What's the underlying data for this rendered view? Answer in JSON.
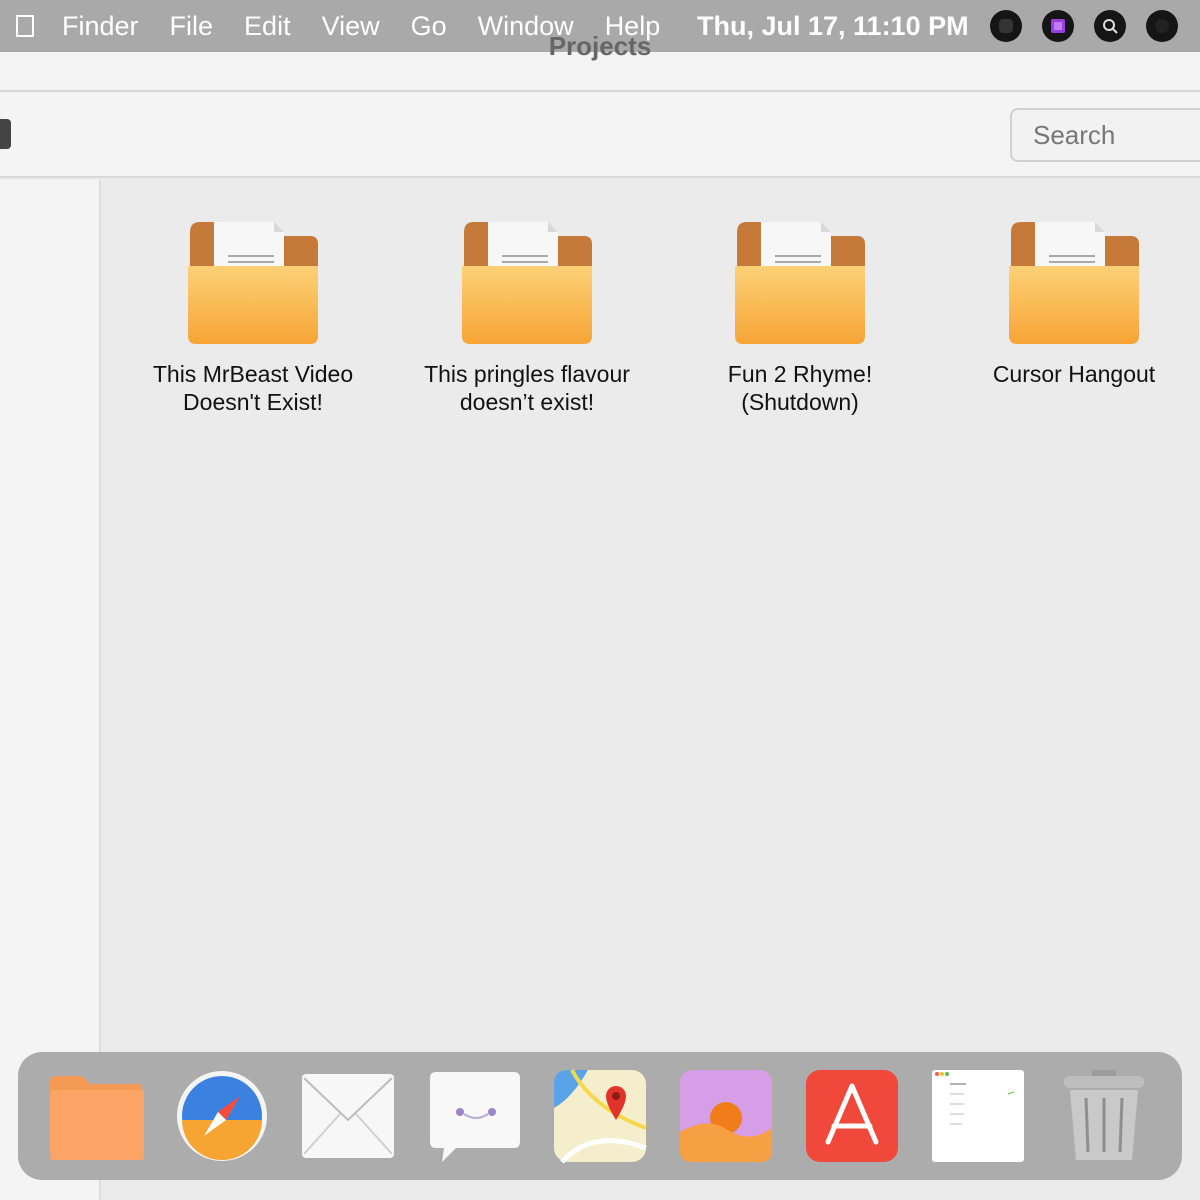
{
  "menubar": {
    "apple_icon": "apple-logo-icon",
    "app_name": "Finder",
    "menus": [
      "File",
      "Edit",
      "View",
      "Go",
      "Window",
      "Help"
    ],
    "clock": "Thu, Jul 17, 11:10 PM",
    "status_icons": [
      "control-center-icon",
      "screen-recorder-icon",
      "spotlight-search-icon",
      "account-icon"
    ]
  },
  "window": {
    "title": "Projects",
    "search_placeholder": "Search"
  },
  "folders": [
    {
      "name": "This MrBeast Video Doesn't Exist!",
      "icon": "document-folder-icon"
    },
    {
      "name": "This pringles flavour doesn’t exist!",
      "icon": "document-folder-icon"
    },
    {
      "name": "Fun 2 Rhyme! (Shutdown)",
      "icon": "document-folder-icon"
    },
    {
      "name": "Cursor Hangout",
      "icon": "document-folder-icon"
    }
  ],
  "dock": {
    "apps": [
      "finder-folder-icon",
      "safari-compass-icon",
      "mail-icon",
      "messages-icon",
      "maps-icon",
      "photos-icon",
      "app-store-icon",
      "notes-window-icon",
      "trash-icon"
    ]
  },
  "colors": {
    "menubar": "#a9a9a9",
    "folder_front": "#f9b347",
    "folder_back": "#c67a3a",
    "dock": "#acacac",
    "app_store": "#f0483a"
  }
}
